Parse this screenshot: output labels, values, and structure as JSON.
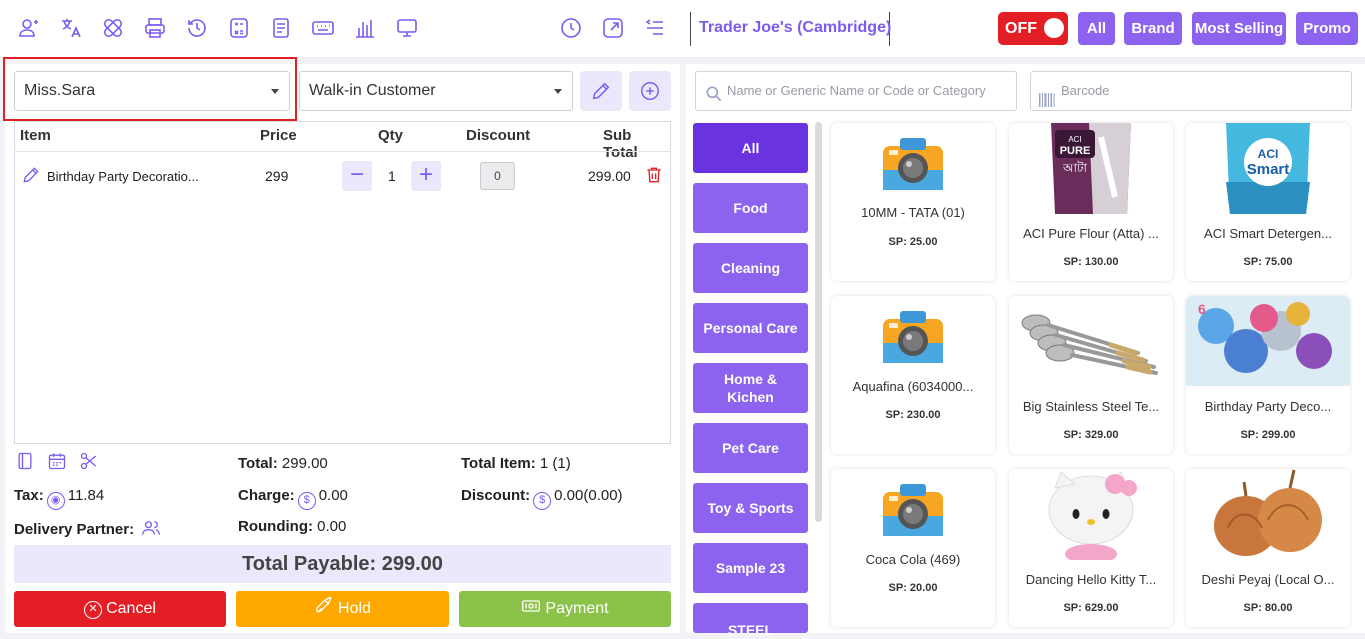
{
  "topbar": {
    "outlet_name": "Trader Joe's (Cambridge)",
    "toggle_label": "OFF",
    "filters": [
      "All",
      "Brand",
      "Most Selling",
      "Promo"
    ]
  },
  "customer": {
    "waiter_selected": "Miss.Sara",
    "customer_selected": "Walk-in Customer"
  },
  "cart": {
    "headers": {
      "item": "Item",
      "price": "Price",
      "qty": "Qty",
      "discount": "Discount",
      "subtotal": "Sub Total"
    },
    "rows": [
      {
        "name": "Birthday Party Decoratio...",
        "price": "299",
        "qty": "1",
        "discount": "0",
        "subtotal": "299.00"
      }
    ]
  },
  "summary": {
    "total_label": "Total:",
    "total": "299.00",
    "total_item_label": "Total Item:",
    "total_item": "1 (1)",
    "tax_label": "Tax:",
    "tax": "11.84",
    "charge_label": "Charge:",
    "charge": "0.00",
    "discount_label": "Discount:",
    "discount": "0.00(0.00)",
    "delivery_label": "Delivery Partner:",
    "rounding_label": "Rounding:",
    "rounding": "0.00",
    "total_payable": "Total Payable: 299.00"
  },
  "actions": {
    "cancel": "Cancel",
    "hold": "Hold",
    "payment": "Payment"
  },
  "search": {
    "placeholder": "Name or Generic Name or Code or Category",
    "barcode_placeholder": "Barcode"
  },
  "categories": [
    "All",
    "Food",
    "Cleaning",
    "Personal Care",
    "Home & Kichen",
    "Pet Care",
    "Toy & Sports",
    "Sample 23",
    "STEEL"
  ],
  "products": [
    {
      "name": "10MM - TATA (01)",
      "price": "SP: 25.00",
      "image": "camera-placeholder"
    },
    {
      "name": "ACI Pure Flour (Atta) ...",
      "price": "SP: 130.00",
      "image": "flour-bag"
    },
    {
      "name": "ACI Smart Detergen...",
      "price": "SP: 75.00",
      "image": "detergent-bag"
    },
    {
      "name": "Aquafina (6034000...",
      "price": "SP: 230.00",
      "image": "camera-placeholder"
    },
    {
      "name": "Big Stainless Steel Te...",
      "price": "SP: 329.00",
      "image": "steel-spoons"
    },
    {
      "name": "Birthday Party Deco...",
      "price": "SP: 299.00",
      "image": "party-balloons"
    },
    {
      "name": "Coca Cola (469)",
      "price": "SP: 20.00",
      "image": "camera-placeholder"
    },
    {
      "name": "Dancing Hello Kitty T...",
      "price": "SP: 629.00",
      "image": "hello-kitty-toy"
    },
    {
      "name": "Deshi Peyaj (Local O...",
      "price": "SP: 80.00",
      "image": "onions"
    }
  ],
  "colors": {
    "accent": "#8b63ee",
    "accent_dark": "#6a33e0",
    "danger": "#e31e24",
    "hold": "#ffa800",
    "payment": "#8bc34a"
  }
}
